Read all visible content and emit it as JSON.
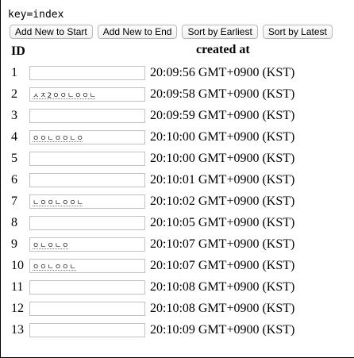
{
  "key_label": "key=index",
  "toolbar": {
    "add_start": "Add New to Start",
    "add_end": "Add New to End",
    "sort_earliest": "Sort by Earliest",
    "sort_latest": "Sort by Latest"
  },
  "table": {
    "headers": {
      "id": "ID",
      "created_at": "created at"
    },
    "rows": [
      {
        "id": "1",
        "value": "",
        "time": "20:09:56 GMT+0900 (KST)"
      },
      {
        "id": "2",
        "value": "ㅅㅈ2ㅇㅇㄴㅇㅇㄴ",
        "time": "20:09:58 GMT+0900 (KST)"
      },
      {
        "id": "3",
        "value": "",
        "time": "20:09:59 GMT+0900 (KST)"
      },
      {
        "id": "4",
        "value": "ㅇㅇㄴㅇㅇㄴㅇ",
        "time": "20:10:00 GMT+0900 (KST)"
      },
      {
        "id": "5",
        "value": "",
        "time": "20:10:00 GMT+0900 (KST)"
      },
      {
        "id": "6",
        "value": "",
        "time": "20:10:01 GMT+0900 (KST)"
      },
      {
        "id": "7",
        "value": "ㄴㅇㅇㄴㅇㅇㄴ",
        "time": "20:10:02 GMT+0900 (KST)"
      },
      {
        "id": "8",
        "value": "",
        "time": "20:10:05 GMT+0900 (KST)"
      },
      {
        "id": "9",
        "value": "ㅇㄴㅇㄴㅇ",
        "time": "20:10:07 GMT+0900 (KST)"
      },
      {
        "id": "10",
        "value": "ㅇㅇㄴㅇㅇㄴ",
        "time": "20:10:07 GMT+0900 (KST)"
      },
      {
        "id": "11",
        "value": "",
        "time": "20:10:08 GMT+0900 (KST)"
      },
      {
        "id": "12",
        "value": "",
        "time": "20:10:08 GMT+0900 (KST)"
      },
      {
        "id": "13",
        "value": "",
        "time": "20:10:09 GMT+0900 (KST)"
      }
    ]
  }
}
